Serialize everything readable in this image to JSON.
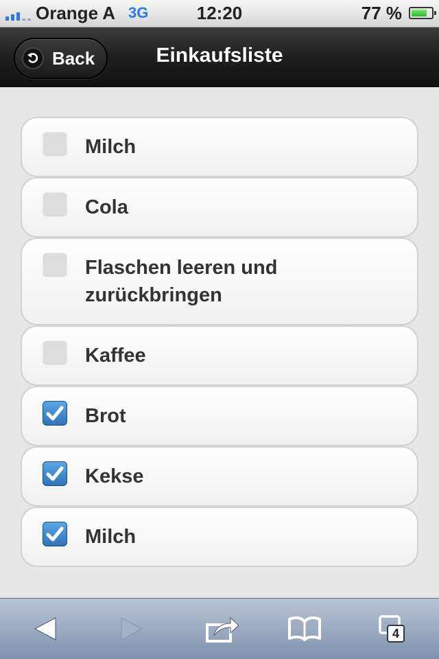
{
  "status": {
    "carrier": "Orange A",
    "network": "3G",
    "time": "12:20",
    "battery": "77 %",
    "battery_level": 0.77
  },
  "header": {
    "back_label": "Back",
    "title": "Einkaufsliste"
  },
  "items": [
    {
      "label": "Milch",
      "checked": false
    },
    {
      "label": "Cola",
      "checked": false
    },
    {
      "label": "Flaschen leeren und zurückbringen",
      "checked": false
    },
    {
      "label": "Kaffee",
      "checked": false
    },
    {
      "label": "Brot",
      "checked": true
    },
    {
      "label": "Kekse",
      "checked": true
    },
    {
      "label": "Milch",
      "checked": true
    }
  ],
  "toolbar": {
    "back_icon": "back-arrow-icon",
    "forward_icon": "forward-arrow-icon",
    "share_icon": "share-icon",
    "bookmarks_icon": "bookmarks-icon",
    "tabs_icon": "tabs-icon",
    "tabs_count": "4"
  },
  "colors": {
    "header": "#1f1f1f",
    "checkbox_checked": "#2f73b8",
    "toolbar": "#8ea0b8"
  }
}
